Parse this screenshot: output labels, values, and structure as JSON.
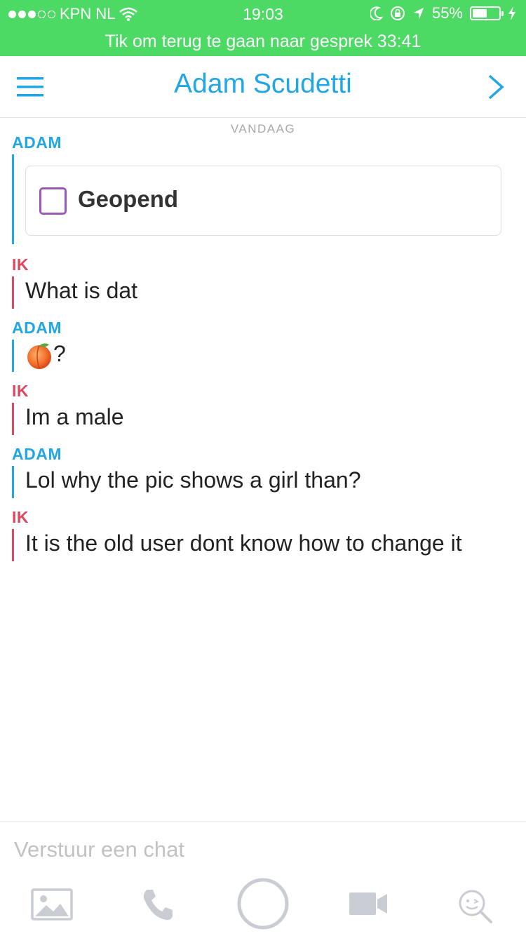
{
  "status_bar": {
    "carrier": "KPN NL",
    "time": "19:03",
    "battery": "55%",
    "battery_level": 0.55
  },
  "call_banner": "Tik om terug te gaan naar gesprek 33:41",
  "header": {
    "title": "Adam Scudetti",
    "menu_icon": "hamburger-menu-icon",
    "next_icon": "chevron-right-icon"
  },
  "chat": {
    "day_label": "VANDAAG",
    "messages": [
      {
        "sender": "ADAM",
        "type": "snap",
        "text": "Geopend"
      },
      {
        "sender": "IK",
        "type": "text",
        "text": "What is dat"
      },
      {
        "sender": "ADAM",
        "type": "emoji",
        "emoji": "peach-emoji",
        "text": "?"
      },
      {
        "sender": "IK",
        "type": "text",
        "text": "Im a male"
      },
      {
        "sender": "ADAM",
        "type": "text",
        "text": "Lol why the pic shows a girl than?"
      },
      {
        "sender": "IK",
        "type": "text",
        "text": "It is the old user dont know how to change it"
      }
    ]
  },
  "input": {
    "placeholder": "Verstuur een chat"
  },
  "colors": {
    "status_green": "#4cd964",
    "adam_blue": "#21a6e6",
    "me_red": "#e0465e",
    "snap_purple": "#9b59b6"
  }
}
